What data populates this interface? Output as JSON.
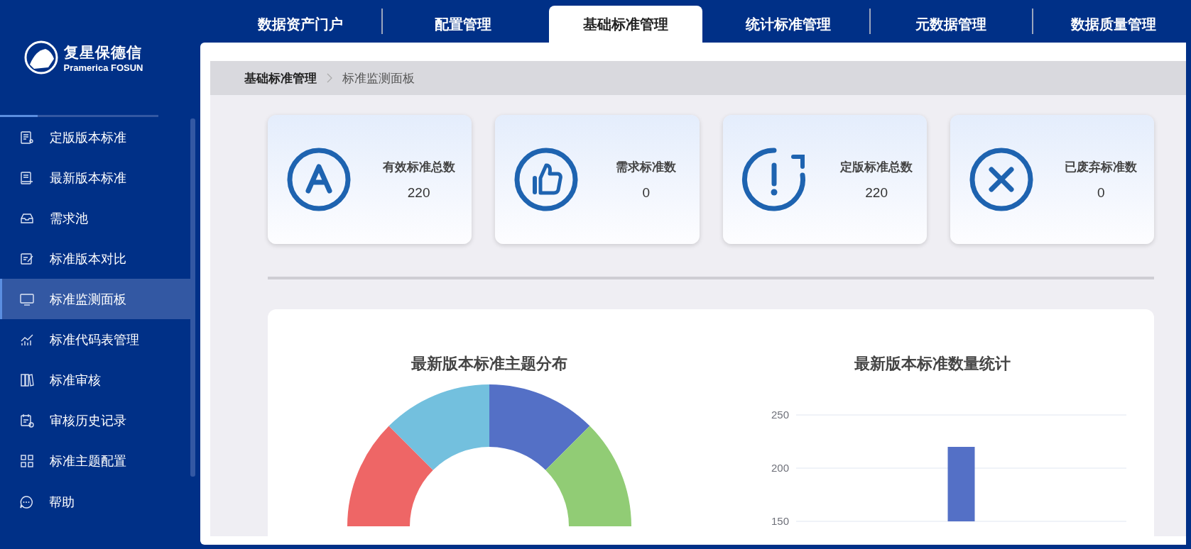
{
  "logo": {
    "name": "复星保德信",
    "subtitle": "Pramerica FOSUN"
  },
  "top_tabs": [
    {
      "label": "数据资产门户",
      "selected": false
    },
    {
      "label": "配置管理",
      "selected": false
    },
    {
      "label": "基础标准管理",
      "selected": true
    },
    {
      "label": "统计标准管理",
      "selected": false
    },
    {
      "label": "元数据管理",
      "selected": false
    },
    {
      "label": "数据质量管理",
      "selected": false
    }
  ],
  "sidebar": {
    "items": [
      {
        "label": "定版版本标准",
        "selected": false
      },
      {
        "label": "最新版本标准",
        "selected": false
      },
      {
        "label": "需求池",
        "selected": false
      },
      {
        "label": "标准版本对比",
        "selected": false
      },
      {
        "label": "标准监测面板",
        "selected": true
      },
      {
        "label": "标准代码表管理",
        "selected": false
      },
      {
        "label": "标准审核",
        "selected": false
      },
      {
        "label": "审核历史记录",
        "selected": false
      },
      {
        "label": "标准主题配置",
        "selected": false
      }
    ],
    "help": "帮助"
  },
  "breadcrumb": [
    "基础标准管理",
    "标准监测面板"
  ],
  "stat_cards": [
    {
      "label": "有效标准总数",
      "value": "220"
    },
    {
      "label": "需求标准数",
      "value": "0"
    },
    {
      "label": "定版标准总数",
      "value": "220"
    },
    {
      "label": "已废弃标准数",
      "value": "0"
    }
  ],
  "donut_panel": {
    "title": "最新版本标准主题分布"
  },
  "bar_panel": {
    "title": "最新版本标准数量统计",
    "chart_data": {
      "type": "bar",
      "values": [
        220
      ],
      "ylim": [
        150,
        250
      ],
      "yticks": [
        150,
        200,
        250
      ]
    }
  }
}
